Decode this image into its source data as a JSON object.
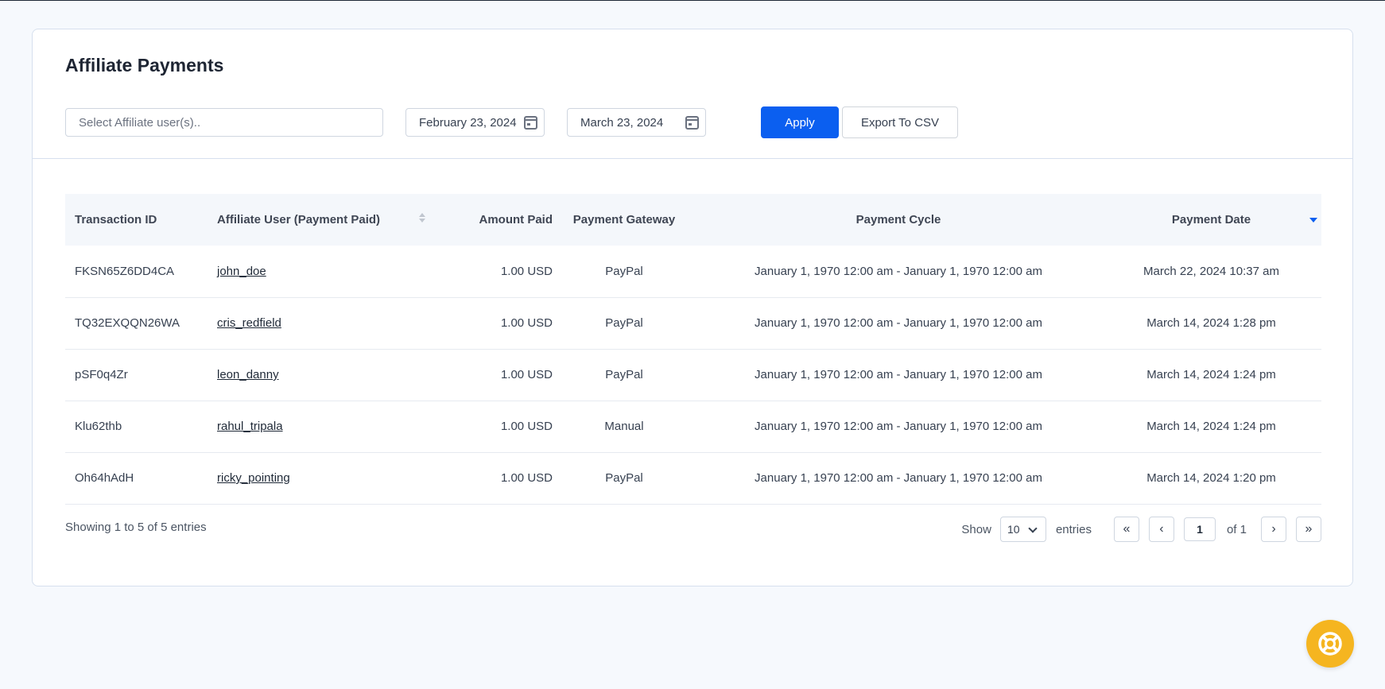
{
  "page": {
    "title": "Affiliate Payments"
  },
  "filters": {
    "affiliate_placeholder": "Select Affiliate user(s)..",
    "date_from": "February 23, 2024",
    "date_to": "March 23, 2024",
    "apply_label": "Apply",
    "export_label": "Export To CSV"
  },
  "table": {
    "headers": {
      "transaction_id": "Transaction ID",
      "affiliate_user": "Affiliate User (Payment Paid)",
      "amount_paid": "Amount Paid",
      "payment_gateway": "Payment Gateway",
      "payment_cycle": "Payment Cycle",
      "payment_date": "Payment Date"
    },
    "rows": [
      {
        "id": "FKSN65Z6DD4CA",
        "user": "john_doe",
        "amount": "1.00 USD",
        "gateway": "PayPal",
        "cycle": "January 1, 1970 12:00 am - January 1, 1970 12:00 am",
        "date": "March 22, 2024 10:37 am"
      },
      {
        "id": "TQ32EXQQN26WA",
        "user": "cris_redfield",
        "amount": "1.00 USD",
        "gateway": "PayPal",
        "cycle": "January 1, 1970 12:00 am - January 1, 1970 12:00 am",
        "date": "March 14, 2024 1:28 pm"
      },
      {
        "id": "pSF0q4Zr",
        "user": "leon_danny",
        "amount": "1.00 USD",
        "gateway": "PayPal",
        "cycle": "January 1, 1970 12:00 am - January 1, 1970 12:00 am",
        "date": "March 14, 2024 1:24 pm"
      },
      {
        "id": "Klu62thb",
        "user": "rahul_tripala",
        "amount": "1.00 USD",
        "gateway": "Manual",
        "cycle": "January 1, 1970 12:00 am - January 1, 1970 12:00 am",
        "date": "March 14, 2024 1:24 pm"
      },
      {
        "id": "Oh64hAdH",
        "user": "ricky_pointing",
        "amount": "1.00 USD",
        "gateway": "PayPal",
        "cycle": "January 1, 1970 12:00 am - January 1, 1970 12:00 am",
        "date": "March 14, 2024 1:20 pm"
      }
    ]
  },
  "footer": {
    "showing_text": "Showing 1 to 5 of 5 entries",
    "show_label": "Show",
    "page_length": "10",
    "entries_label": "entries",
    "first_label": "«",
    "prev_label": "‹",
    "current_page": "1",
    "of_label": "of 1",
    "next_label": "›",
    "last_label": "»"
  },
  "colors": {
    "accent": "#0b5ff0",
    "help_fab": "#f5b520"
  },
  "icons": {
    "calendar": "calendar-icon",
    "sort": "sort-icon",
    "help": "lifebuoy-icon"
  }
}
